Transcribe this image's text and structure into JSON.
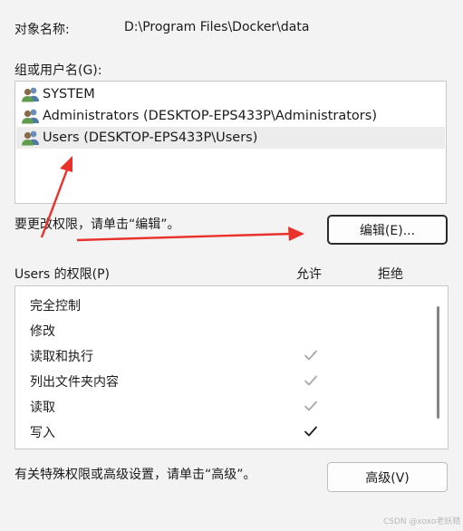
{
  "object": {
    "label": "对象名称:",
    "value": "D:\\Program Files\\Docker\\data"
  },
  "groups": {
    "label": "组或用户名(G):",
    "items": [
      {
        "name": "SYSTEM",
        "icon": "users-icon"
      },
      {
        "name": "Administrators (DESKTOP-EPS433P\\Administrators)",
        "icon": "users-icon"
      },
      {
        "name": "Users (DESKTOP-EPS433P\\Users)",
        "icon": "users-icon",
        "selected": true
      }
    ]
  },
  "edit": {
    "hint": "要更改权限，请单击“编辑”。",
    "button": "编辑(E)..."
  },
  "permissions": {
    "label": "Users 的权限(P)",
    "allow_header": "允许",
    "deny_header": "拒绝",
    "rows": [
      {
        "name": "完全控制",
        "allow": "none",
        "deny": "none"
      },
      {
        "name": "修改",
        "allow": "none",
        "deny": "none"
      },
      {
        "name": "读取和执行",
        "allow": "inherited",
        "deny": "none"
      },
      {
        "name": "列出文件夹内容",
        "allow": "inherited",
        "deny": "none"
      },
      {
        "name": "读取",
        "allow": "inherited",
        "deny": "none"
      },
      {
        "name": "写入",
        "allow": "explicit",
        "deny": "none"
      }
    ]
  },
  "advanced": {
    "hint": "有关特殊权限或高级设置，请单击“高级”。",
    "button": "高级(V)"
  },
  "watermark": "CSDN @xoxo老妖精",
  "colors": {
    "annotation_arrow": "#e8322b",
    "check_dark": "#1f1f1f",
    "check_inherited": "#a6a6a6"
  }
}
